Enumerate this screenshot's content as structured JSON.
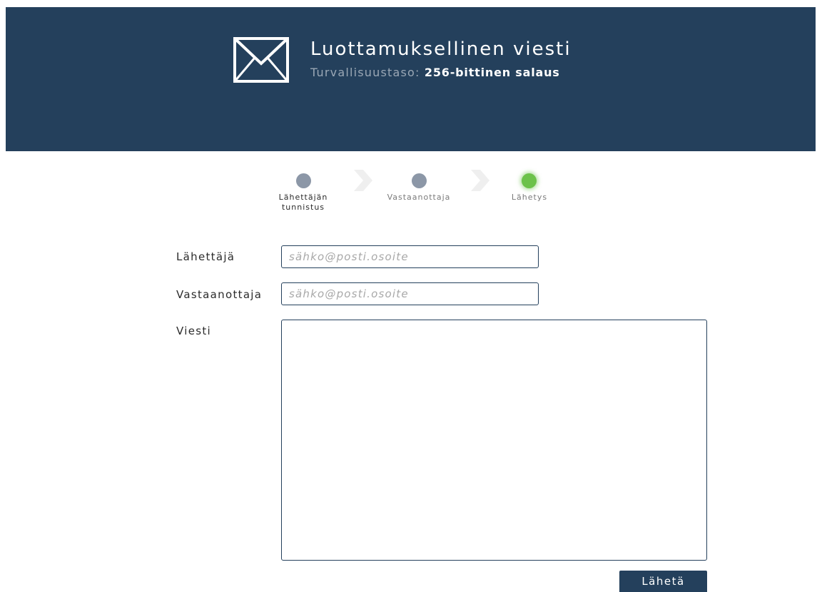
{
  "header": {
    "title": "Luottamuksellinen viesti",
    "security_label": "Turvallisuustaso:",
    "security_value": "256-bittinen salaus",
    "icon": "envelope-icon",
    "background_color": "#24405c"
  },
  "steps": [
    {
      "label_line1": "Lähettäjän",
      "label_line2": "tunnistus",
      "status": "done"
    },
    {
      "label_line1": "Vastaanottaja",
      "label_line2": "",
      "status": "pending"
    },
    {
      "label_line1": "Lähetys",
      "label_line2": "",
      "status": "active"
    }
  ],
  "form": {
    "sender": {
      "label": "Lähettäjä",
      "value": "",
      "placeholder": "sähko@posti.osoite"
    },
    "recipient": {
      "label": "Vastaanottaja",
      "value": "",
      "placeholder": "sähko@posti.osoite"
    },
    "message": {
      "label": "Viesti",
      "value": ""
    },
    "submit_label": "Lähetä"
  },
  "colors": {
    "primary": "#24405c",
    "step_inactive": "#8c97a7",
    "step_active": "#6cc24a",
    "placeholder": "#a8a8a8"
  }
}
